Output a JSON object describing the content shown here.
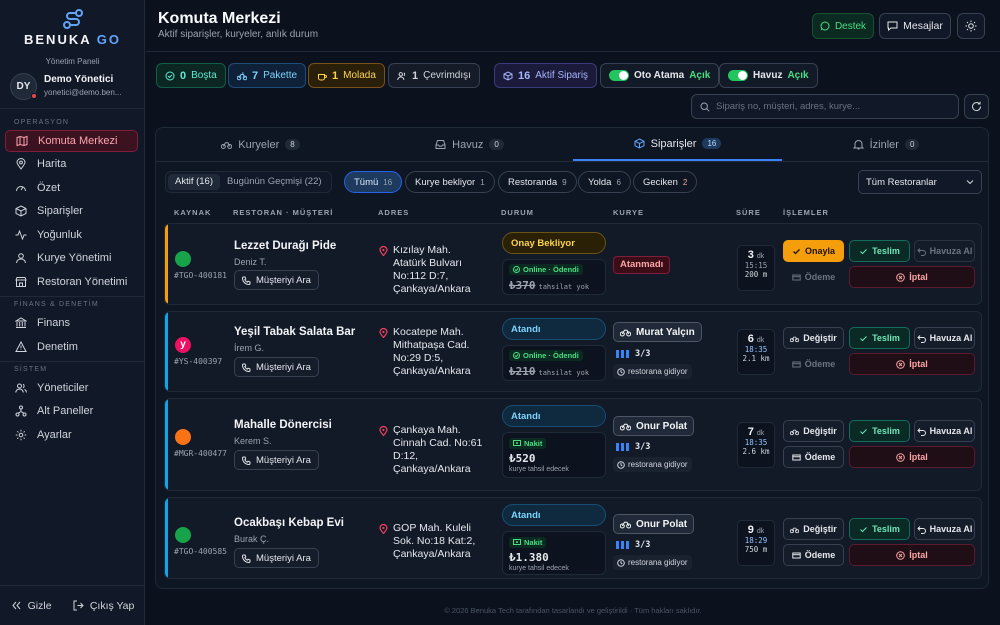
{
  "brand": {
    "name_main": "BENUKA",
    "name_accent": "GO",
    "panel_label": "Yönetim Paneli"
  },
  "user": {
    "initials": "DY",
    "name": "Demo Yönetici",
    "email": "yonetici@demo.ben..."
  },
  "sidebar": {
    "sections": [
      "OPERASYON",
      "FİNANS & DENETİM",
      "SİSTEM"
    ],
    "items": [
      {
        "label": "Komuta Merkezi",
        "icon": "map-icon",
        "active": true
      },
      {
        "label": "Harita",
        "icon": "pin-icon"
      },
      {
        "label": "Özet",
        "icon": "gauge-icon"
      },
      {
        "label": "Siparişler",
        "icon": "box-icon"
      },
      {
        "label": "Yoğunluk",
        "icon": "activity-icon"
      },
      {
        "label": "Kurye Yönetimi",
        "icon": "user-icon"
      },
      {
        "label": "Restoran Yönetimi",
        "icon": "shop-icon"
      },
      {
        "label": "Finans",
        "icon": "bank-icon"
      },
      {
        "label": "Denetim",
        "icon": "alert-icon"
      },
      {
        "label": "Yöneticiler",
        "icon": "users-icon"
      },
      {
        "label": "Alt Paneller",
        "icon": "share-icon"
      },
      {
        "label": "Ayarlar",
        "icon": "gear-icon"
      }
    ],
    "hide": "Gizle",
    "logout": "Çıkış Yap"
  },
  "header": {
    "title": "Komuta Merkezi",
    "subtitle": "Aktif siparişler, kuryeler, anlık durum",
    "support": "Destek",
    "messages": "Mesajlar"
  },
  "stats": {
    "idle": {
      "value": "0",
      "label": "Boşta"
    },
    "in_package": {
      "value": "7",
      "label": "Pakette"
    },
    "break": {
      "value": "1",
      "label": "Molada"
    },
    "offline": {
      "value": "1",
      "label": "Çevrimdışı"
    },
    "active_orders": {
      "value": "16",
      "label": "Aktif Sipariş"
    },
    "auto_assign": {
      "label": "Oto Atama",
      "state": "Açık"
    },
    "pool": {
      "label": "Havuz",
      "state": "Açık"
    }
  },
  "search": {
    "placeholder": "Sipariş no, müşteri, adres, kurye..."
  },
  "tabs": [
    {
      "label": "Kuryeler",
      "count": "8"
    },
    {
      "label": "Havuz",
      "count": "0"
    },
    {
      "label": "Siparişler",
      "count": "16"
    },
    {
      "label": "İzinler",
      "count": "0"
    }
  ],
  "segment": {
    "active": "Aktif (16)",
    "history": "Bugünün Geçmişi (22)"
  },
  "filters": [
    {
      "label": "Tümü",
      "count": "16"
    },
    {
      "label": "Kurye bekliyor",
      "count": "1"
    },
    {
      "label": "Restoranda",
      "count": "9"
    },
    {
      "label": "Yolda",
      "count": "6"
    },
    {
      "label": "Geciken",
      "count": "2"
    }
  ],
  "restaurant_filter": "Tüm Restoranlar",
  "columns": [
    "KAYNAK",
    "RESTORAN · MÜŞTERİ",
    "ADRES",
    "DURUM",
    "KURYE",
    "SÜRE",
    "İŞLEMLER"
  ],
  "colors": {
    "accent": "#3b82f6",
    "warning": "#f59e0b",
    "success": "#22c55e",
    "danger": "#ef4444"
  },
  "orders": [
    {
      "id": "#TGO-400181",
      "restaurant": "Lezzet Durağı Pide",
      "customer": "Deniz T.",
      "call": "Müşteriyi Ara",
      "address": "Kızılay Mah. Atatürk Bulvarı No:112 D:7, Çankaya/Ankara",
      "status": "Onay Bekliyor",
      "payment_badge": "Online · Ödendi",
      "amount": "₺370",
      "amount_note": "tahsilat yok",
      "courier": "Atanmadı",
      "minutes": "3",
      "min_unit": "dk",
      "clock": "15:15",
      "distance": "200 m",
      "actions": {
        "primary": "Onayla",
        "deliver": "Teslim",
        "pool": "Havuza Al",
        "payment": "Ödeme",
        "cancel": "İptal"
      }
    },
    {
      "id": "#YS-400397",
      "restaurant": "Yeşil Tabak Salata Bar",
      "customer": "İrem G.",
      "call": "Müşteriyi Ara",
      "address": "Kocatepe Mah. Mithatpaşa Cad. No:29 D:5, Çankaya/Ankara",
      "status": "Atandı",
      "payment_badge": "Online · Ödendi",
      "amount": "₺210",
      "amount_note": "tahsilat yok",
      "courier": "Murat Yalçın",
      "load": "3/3",
      "courier_state": "restorana gidiyor",
      "minutes": "6",
      "min_unit": "dk",
      "clock": "18:35",
      "distance": "2.1 km",
      "actions": {
        "primary": "Değiştir",
        "deliver": "Teslim",
        "pool": "Havuza Al",
        "payment": "Ödeme",
        "cancel": "İptal"
      }
    },
    {
      "id": "#MGR-400477",
      "restaurant": "Mahalle Dönercisi",
      "customer": "Kerem S.",
      "call": "Müşteriyi Ara",
      "address": "Çankaya Mah. Cinnah Cad. No:61 D:12, Çankaya/Ankara",
      "status": "Atandı",
      "payment_badge": "Nakit",
      "amount": "₺520",
      "amount_note": "kurye tahsil edecek",
      "courier": "Onur Polat",
      "load": "3/3",
      "courier_state": "restorana gidiyor",
      "minutes": "7",
      "min_unit": "dk",
      "clock": "18:35",
      "distance": "2.6 km",
      "actions": {
        "primary": "Değiştir",
        "deliver": "Teslim",
        "pool": "Havuza Al",
        "payment": "Ödeme",
        "cancel": "İptal"
      }
    },
    {
      "id": "#TGO-400585",
      "restaurant": "Ocakbaşı Kebap Evi",
      "customer": "Burak Ç.",
      "call": "Müşteriyi Ara",
      "address": "GOP Mah. Kuleli Sok. No:18 Kat:2, Çankaya/Ankara",
      "status": "Atandı",
      "payment_badge": "Nakit",
      "amount": "₺1.380",
      "amount_note": "kurye tahsil edecek",
      "courier": "Onur Polat",
      "load": "3/3",
      "courier_state": "restorana gidiyor",
      "minutes": "9",
      "min_unit": "dk",
      "clock": "18:29",
      "distance": "750 m",
      "actions": {
        "primary": "Değiştir",
        "deliver": "Teslim",
        "pool": "Havuza Al",
        "payment": "Ödeme",
        "cancel": "İptal"
      }
    }
  ],
  "footer": "© 2026 Benuka Tech tarafından tasarlandı ve geliştirildi · Tüm hakları saklıdır."
}
